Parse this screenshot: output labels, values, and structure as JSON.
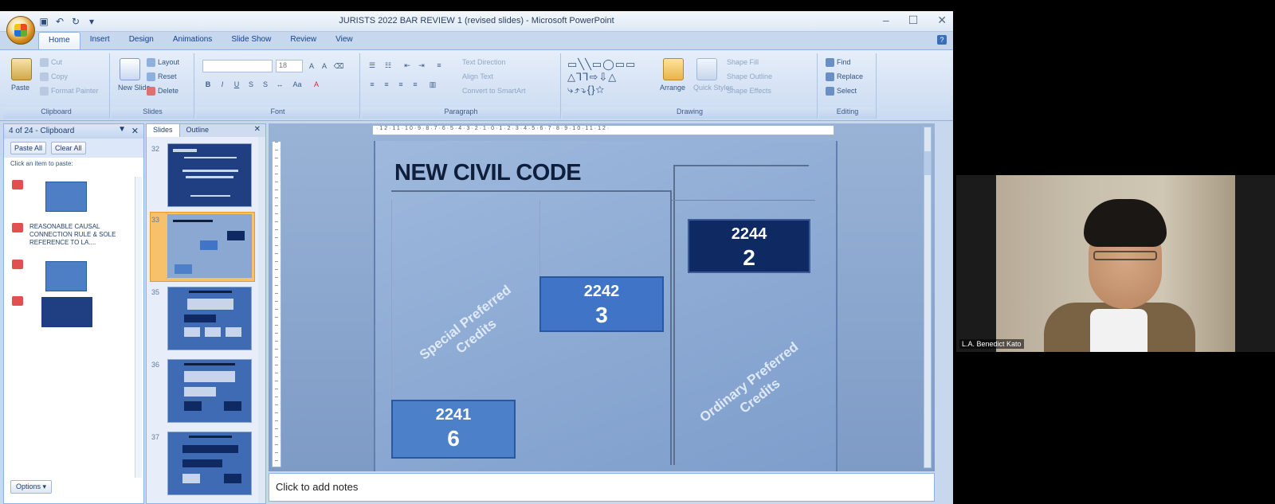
{
  "window": {
    "title": "JURISTS 2022 BAR REVIEW 1 (revised slides) - Microsoft PowerPoint",
    "controls": [
      "–",
      "☐",
      "✕"
    ]
  },
  "ribbon": {
    "tabs": [
      "Home",
      "Insert",
      "Design",
      "Animations",
      "Slide Show",
      "Review",
      "View"
    ],
    "active_tab": "Home",
    "clipboard": {
      "paste": "Paste",
      "cut": "Cut",
      "copy": "Copy",
      "format_painter": "Format Painter",
      "label": "Clipboard"
    },
    "slides": {
      "new_slide": "New Slide",
      "layout": "Layout",
      "reset": "Reset",
      "delete": "Delete",
      "label": "Slides"
    },
    "font": {
      "font_size": "18",
      "label": "Font"
    },
    "paragraph": {
      "text_direction": "Text Direction",
      "align_text": "Align Text",
      "convert": "Convert to SmartArt",
      "label": "Paragraph"
    },
    "drawing": {
      "arrange": "Arrange",
      "quick_styles": "Quick Styles",
      "shape_fill": "Shape Fill",
      "shape_outline": "Shape Outline",
      "shape_effects": "Shape Effects",
      "label": "Drawing"
    },
    "editing": {
      "find": "Find",
      "replace": "Replace",
      "select": "Select",
      "label": "Editing"
    }
  },
  "clipboard_pane": {
    "title": "4 of 24 - Clipboard",
    "paste_all": "Paste All",
    "clear_all": "Clear All",
    "hint": "Click an item to paste:",
    "item_text": "REASONABLE CAUSAL CONNECTION RULE & SOLE REFERENCE TO LA....",
    "options": "Options"
  },
  "slides_pane": {
    "tab_slides": "Slides",
    "tab_outline": "Outline",
    "thumbnails": [
      {
        "number": "32"
      },
      {
        "number": "33"
      },
      {
        "number": "35"
      },
      {
        "number": "36"
      },
      {
        "number": "37"
      }
    ]
  },
  "slide": {
    "title": "NEW CIVIL CODE",
    "left_label": "Special Preferred Credits",
    "right_label": "Ordinary Preferred Credits",
    "boxes": [
      {
        "code": "2244",
        "count": "2"
      },
      {
        "code": "2242",
        "count": "3"
      },
      {
        "code": "2241",
        "count": "6"
      }
    ]
  },
  "notes": {
    "placeholder": "Click to add notes"
  },
  "video": {
    "participant": "L.A. Benedict Kato"
  },
  "colors": {
    "dark_box": "#0f2a63",
    "mid_box": "#3f74c6",
    "light_box": "#4c80c9"
  }
}
